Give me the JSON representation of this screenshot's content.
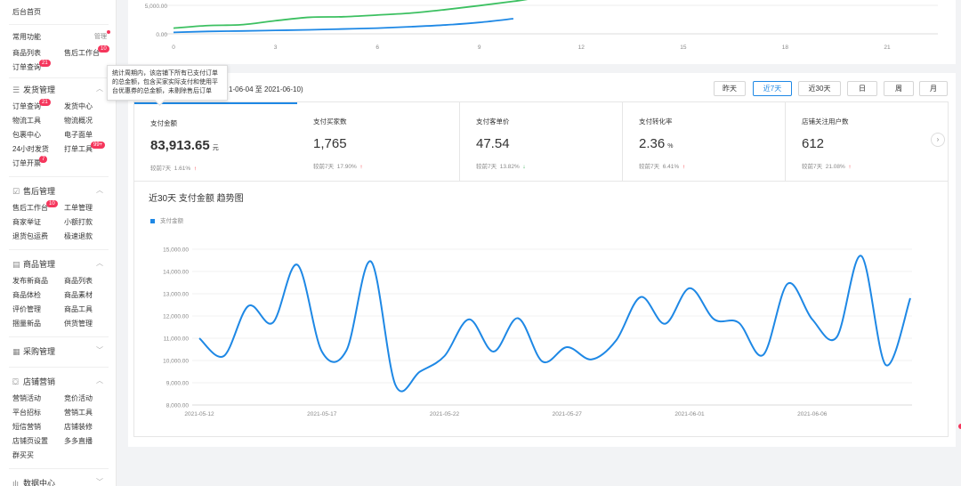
{
  "sidebar": {
    "home": "后台首页",
    "common": {
      "title": "常用功能",
      "manage": "管理",
      "rows": [
        [
          "商品列表",
          "售后工作台"
        ],
        [
          "订单查询",
          ""
        ]
      ]
    },
    "badges": {
      "workbench": "10",
      "orders": "21",
      "open": "7",
      "print": "99+"
    },
    "sections": [
      {
        "title": "发货管理",
        "icon": "☰",
        "rows": [
          [
            "订单查询",
            "发货中心"
          ],
          [
            "物流工具",
            "物流概况"
          ],
          [
            "包裹中心",
            "电子面单"
          ],
          [
            "24小时发货",
            "打单工具"
          ],
          [
            "订单开票",
            ""
          ]
        ]
      },
      {
        "title": "售后管理",
        "icon": "☑",
        "rows": [
          [
            "售后工作台",
            "工单管理"
          ],
          [
            "商家举证",
            "小额打款"
          ],
          [
            "退货包运费",
            "极速退款"
          ]
        ]
      },
      {
        "title": "商品管理",
        "icon": "▤",
        "rows": [
          [
            "发布新商品",
            "商品列表"
          ],
          [
            "商品体检",
            "商品素材"
          ],
          [
            "评价管理",
            "商品工具"
          ],
          [
            "捆量新品",
            "供货管理"
          ]
        ]
      },
      {
        "title": "采购管理",
        "icon": "▦",
        "rows": []
      },
      {
        "title": "店铺营销",
        "icon": "⛋",
        "rows": [
          [
            "营销活动",
            "竞价活动"
          ],
          [
            "平台招标",
            "营销工具"
          ],
          [
            "短信营销",
            "店铺装修"
          ],
          [
            "店铺页设置",
            "多多直播"
          ],
          [
            "群买买",
            ""
          ]
        ]
      },
      {
        "title": "数据中心",
        "icon": "ılı",
        "rows": []
      }
    ]
  },
  "top_chart": {
    "y_labels": [
      "5,000.00",
      "0.00"
    ],
    "x_labels": [
      "0",
      "3",
      "6",
      "9",
      "12",
      "15",
      "18",
      "21"
    ],
    "colors": {
      "green": "#3cc061",
      "blue": "#1e88e5"
    },
    "green": [
      [
        0,
        1000
      ],
      [
        1,
        1450
      ],
      [
        2,
        1600
      ],
      [
        3,
        2300
      ],
      [
        4,
        2900
      ],
      [
        5,
        3000
      ],
      [
        6,
        3300
      ],
      [
        7,
        3650
      ],
      [
        8,
        4250
      ],
      [
        9,
        4950
      ],
      [
        10,
        5700
      ],
      [
        11,
        6550
      ],
      [
        12,
        6900
      ]
    ],
    "blue": [
      [
        0,
        250
      ],
      [
        1,
        420
      ],
      [
        2,
        500
      ],
      [
        3,
        600
      ],
      [
        4,
        700
      ],
      [
        5,
        850
      ],
      [
        6,
        1000
      ],
      [
        7,
        1250
      ],
      [
        8,
        1550
      ],
      [
        9,
        2000
      ],
      [
        10,
        2650
      ]
    ]
  },
  "range_text": "1-06-04 至 2021-06-10)",
  "buttons": [
    "昨天",
    "近7天",
    "近30天",
    "日",
    "周",
    "月"
  ],
  "active_button": 1,
  "tooltip": "统计周期内，该店铺下所有已支付订单的总金额，包含买家实际支付和使用平台优惠券的总金额，未剔除售后订单",
  "kpis": [
    {
      "label": "支付金额",
      "value": "83,913.65",
      "unit": "元",
      "cmp_label": "较前7天",
      "cmp": "1.61%",
      "trend": "up",
      "arrow": "↑"
    },
    {
      "label": "支付买家数",
      "value": "1,765",
      "unit": "",
      "cmp_label": "较前7天",
      "cmp": "17.90%",
      "trend": "up",
      "arrow": "↑"
    },
    {
      "label": "支付客单价",
      "value": "47.54",
      "unit": "",
      "cmp_label": "较前7天",
      "cmp": "13.82%",
      "trend": "down",
      "arrow": "↓"
    },
    {
      "label": "支付转化率",
      "value": "2.36",
      "unit": "%",
      "cmp_label": "较前7天",
      "cmp": "6.41%",
      "trend": "up",
      "arrow": "↑"
    },
    {
      "label": "店铺关注用户数",
      "value": "612",
      "unit": "",
      "cmp_label": "较前7天",
      "cmp": "21.08%",
      "trend": "up",
      "arrow": "↑"
    }
  ],
  "next_arrow": "›",
  "chart_data": {
    "type": "line",
    "title": "近30天 支付金额 趋势图",
    "series_name": "支付金额",
    "color": "#1e88e5",
    "ylim": [
      8000,
      15000
    ],
    "y_ticks": [
      "15,000.00",
      "14,000.00",
      "13,000.00",
      "12,000.00",
      "11,000.00",
      "10,000.00",
      "9,000.00",
      "8,000.00"
    ],
    "x_ticks": [
      "2021-05-12",
      "2021-05-17",
      "2021-05-22",
      "2021-05-27",
      "2021-06-01",
      "2021-06-06"
    ],
    "x": [
      "2021-05-12",
      "2021-05-13",
      "2021-05-14",
      "2021-05-15",
      "2021-05-16",
      "2021-05-17",
      "2021-05-18",
      "2021-05-19",
      "2021-05-20",
      "2021-05-21",
      "2021-05-22",
      "2021-05-23",
      "2021-05-24",
      "2021-05-25",
      "2021-05-26",
      "2021-05-27",
      "2021-05-28",
      "2021-05-29",
      "2021-05-30",
      "2021-05-31",
      "2021-06-01",
      "2021-06-02",
      "2021-06-03",
      "2021-06-04",
      "2021-06-05",
      "2021-06-06",
      "2021-06-07",
      "2021-06-08",
      "2021-06-09",
      "2021-06-10"
    ],
    "values": [
      11000,
      10200,
      12450,
      11700,
      14300,
      10400,
      10450,
      14450,
      8900,
      9500,
      10200,
      11850,
      10400,
      11900,
      9950,
      10600,
      10050,
      10900,
      12850,
      11650,
      13250,
      11850,
      11700,
      10250,
      13450,
      11850,
      11050,
      14700,
      9800,
      12800
    ]
  }
}
